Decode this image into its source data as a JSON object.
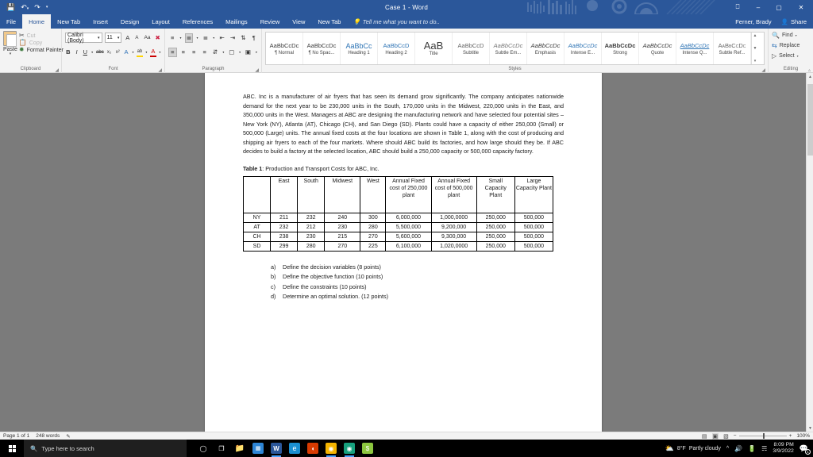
{
  "window": {
    "title": "Case 1 - Word",
    "user": "Ferner, Brady",
    "share_label": "Share",
    "qat": {
      "save": "save-icon",
      "undo": "undo-icon",
      "redo": "redo-icon",
      "more": "more-icon"
    },
    "buttons": {
      "ribbon_display": "ribbon-display-icon",
      "minimize": "–",
      "restore": "▢",
      "close": "✕"
    }
  },
  "ribbon": {
    "tabs": [
      {
        "label": "File"
      },
      {
        "label": "Home"
      },
      {
        "label": "New Tab"
      },
      {
        "label": "Insert"
      },
      {
        "label": "Design"
      },
      {
        "label": "Layout"
      },
      {
        "label": "References"
      },
      {
        "label": "Mailings"
      },
      {
        "label": "Review"
      },
      {
        "label": "View"
      },
      {
        "label": "New Tab"
      }
    ],
    "active_tab": "Home",
    "tell_me": "Tell me what you want to do..",
    "groups": {
      "clipboard": {
        "label": "Clipboard",
        "paste": "Paste",
        "cut": "Cut",
        "copy": "Copy",
        "format_painter": "Format Painter"
      },
      "font": {
        "label": "Font",
        "font_name": "Calibri (Body)",
        "font_size": "11",
        "grow": "A",
        "shrink": "A",
        "change_case": "Aa",
        "clear_formatting": "clear-formatting-icon",
        "bold": "B",
        "italic": "I",
        "underline": "U",
        "strikethrough": "abc",
        "subscript": "x₂",
        "superscript": "x²",
        "text_effects": "A",
        "highlight": "ab",
        "font_color": "A"
      },
      "paragraph": {
        "label": "Paragraph"
      },
      "styles": {
        "label": "Styles",
        "items": [
          {
            "preview": "AaBbCcDc",
            "name": "¶ Normal"
          },
          {
            "preview": "AaBbCcDc",
            "name": "¶ No Spac..."
          },
          {
            "preview": "AaBbCc",
            "name": "Heading 1"
          },
          {
            "preview": "AaBbCcD",
            "name": "Heading 2"
          },
          {
            "preview": "AaB",
            "name": "Title"
          },
          {
            "preview": "AaBbCcD",
            "name": "Subtitle"
          },
          {
            "preview": "AaBbCcDc",
            "name": "Subtle Em..."
          },
          {
            "preview": "AaBbCcDc",
            "name": "Emphasis"
          },
          {
            "preview": "AaBbCcDc",
            "name": "Intense E..."
          },
          {
            "preview": "AaBbCcDc",
            "name": "Strong"
          },
          {
            "preview": "AaBbCcDc",
            "name": "Quote"
          },
          {
            "preview": "AaBbCcDc",
            "name": "Intense Q..."
          },
          {
            "preview": "AaBbCcDc",
            "name": "Subtle Ref..."
          }
        ]
      },
      "editing": {
        "label": "Editing",
        "find": "Find",
        "replace": "Replace",
        "select": "Select"
      }
    }
  },
  "document": {
    "paragraph": "ABC. Inc is a manufacturer of air fryers that has seen its demand grow significantly. The company anticipates nationwide demand for the next year to be 230,000 units in the South, 170,000 units in the Midwest, 220,000 units in the East, and 350,000 units in the West. Managers at ABC are designing the manufacturing network and have selected four potential sites – New York (NY), Atlanta (AT), Chicago (CH), and San Diego (SD). Plants could have a capacity of either 250,000 (Small) or 500,000 (Large) units. The annual fixed costs at the four locations are shown in Table 1, along with the cost of producing and shipping air fryers to each of the four markets. Where should ABC build its factories, and how large should they be. If ABC decides to build a factory at the selected location, ABC should build a 250,000 capacity or 500,000 capacity factory.",
    "table_caption_label": "Table 1",
    "table_caption_text": ": Production and Transport Costs for ABC, Inc.",
    "table": {
      "headers": [
        "",
        "East",
        "South",
        "Midwest",
        "West",
        "Annual Fixed cost of 250,000 plant",
        "Annual Fixed cost of 500,000 plant",
        "Small Capacity Plant",
        "Large Capacity Plant"
      ],
      "rows": [
        [
          "NY",
          "211",
          "232",
          "240",
          "300",
          "6,000,000",
          "1,000,0000",
          "250,000",
          "500,000"
        ],
        [
          "AT",
          "232",
          "212",
          "230",
          "280",
          "5,500,000",
          "9,200,000",
          "250,000",
          "500,000"
        ],
        [
          "CH",
          "238",
          "230",
          "215",
          "270",
          "5,600,000",
          "9,300,000",
          "250,000",
          "500,000"
        ],
        [
          "SD",
          "299",
          "280",
          "270",
          "225",
          "6,100,000",
          "1,020,0000",
          "250,000",
          "500,000"
        ]
      ]
    },
    "questions": [
      {
        "marker": "a)",
        "text": "Define the decision variables (8 points)"
      },
      {
        "marker": "b)",
        "text": "Define the objective function (10 points)"
      },
      {
        "marker": "c)",
        "text": "Define the constraints (10 points)"
      },
      {
        "marker": "d)",
        "text": "Determine an optimal solution. (12 points)"
      }
    ]
  },
  "statusbar": {
    "page": "Page 1 of 1",
    "words": "248 words",
    "proofing": "proofing-icon",
    "views": {
      "read": "read-mode-icon",
      "print": "print-layout-icon",
      "web": "web-layout-icon"
    },
    "zoom_out": "−",
    "zoom_in": "+",
    "zoom_level": "100%"
  },
  "taskbar": {
    "search_placeholder": "Type here to search",
    "icons": [
      {
        "name": "cortana-icon",
        "glyph": "◯",
        "color": "#ffffff",
        "bg": "transparent"
      },
      {
        "name": "task-view-icon",
        "glyph": "❑",
        "color": "#ffffff",
        "bg": "transparent"
      },
      {
        "name": "file-explorer-icon",
        "glyph": "🗀",
        "color": "#ffc83d",
        "bg": "transparent"
      },
      {
        "name": "microsoft-store-icon",
        "glyph": "▦",
        "color": "#ffffff",
        "bg": "#2e86d6"
      },
      {
        "name": "word-icon",
        "glyph": "W",
        "color": "#ffffff",
        "bg": "#2b579a"
      },
      {
        "name": "edge-icon",
        "glyph": "e",
        "color": "#ffffff",
        "bg": "#1a8fd1"
      },
      {
        "name": "office-icon",
        "glyph": "◗",
        "color": "#ffffff",
        "bg": "#d83b01"
      },
      {
        "name": "chrome-icon",
        "glyph": "◉",
        "color": "#ffffff",
        "bg": "#f4b400"
      },
      {
        "name": "teal-app-icon",
        "glyph": "◎",
        "color": "#ffffff",
        "bg": "#17a07d"
      },
      {
        "name": "green-app-icon",
        "glyph": "$",
        "color": "#ffffff",
        "bg": "#8cc63f"
      }
    ],
    "tray": {
      "weather_temp": "8°F",
      "weather_desc": "Partly cloudy",
      "chevron": "^",
      "volume": "volume-icon",
      "battery": "battery-icon",
      "network": "network-icon",
      "time": "8:09 PM",
      "date": "3/9/2022",
      "notification_count": "1"
    }
  },
  "colors": {
    "word_blue": "#2b579a",
    "ribbon_bg": "#f3f3f3",
    "canvas_gray": "#7b7b7b",
    "page_white": "#ffffff"
  }
}
